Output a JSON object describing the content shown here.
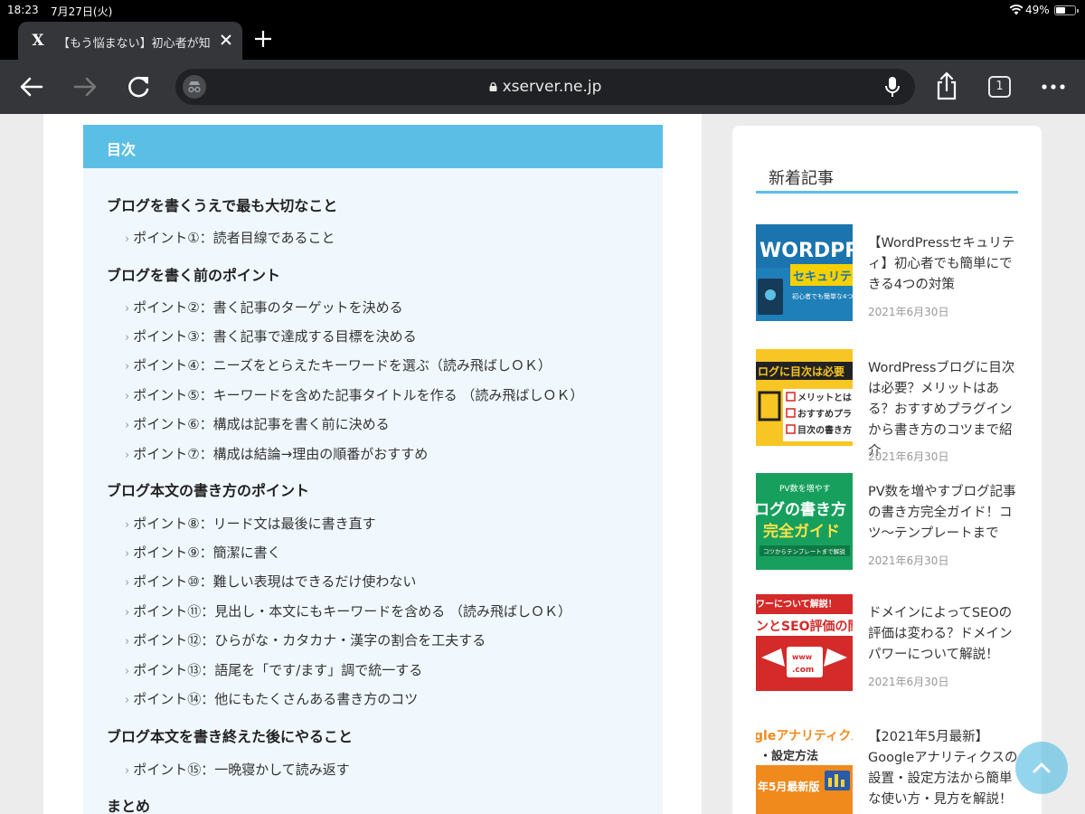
{
  "status_bar": {
    "time": "18:23",
    "date": "7月27日(火)",
    "battery": "49%",
    "battery_level": 0.49
  },
  "browser": {
    "tab_title": "【もう悩まない】初心者が知",
    "url": "xserver.ne.jp",
    "tab_count": "1",
    "favicon": "X"
  },
  "toc": {
    "header": "目次",
    "items": [
      {
        "level": "h2",
        "text": "ブログを書くうえで最も大切なこと"
      },
      {
        "level": "h3",
        "text": "ポイント①：読者目線であること"
      },
      {
        "level": "h2",
        "text": "ブログを書く前のポイント"
      },
      {
        "level": "h3",
        "text": "ポイント②：書く記事のターゲットを決める"
      },
      {
        "level": "h3",
        "text": "ポイント③：書く記事で達成する目標を決める"
      },
      {
        "level": "h3",
        "text": "ポイント④：ニーズをとらえたキーワードを選ぶ（読み飛ばしＯＫ）"
      },
      {
        "level": "h3",
        "text": "ポイント⑤：キーワードを含めた記事タイトルを作る （読み飛ばしＯＫ）"
      },
      {
        "level": "h3",
        "text": "ポイント⑥：構成は記事を書く前に決める"
      },
      {
        "level": "h3",
        "text": "ポイント⑦：構成は結論→理由の順番がおすすめ"
      },
      {
        "level": "h2",
        "text": "ブログ本文の書き方のポイント"
      },
      {
        "level": "h3",
        "text": "ポイント⑧：リード文は最後に書き直す"
      },
      {
        "level": "h3",
        "text": "ポイント⑨：簡潔に書く"
      },
      {
        "level": "h3",
        "text": "ポイント⑩：難しい表現はできるだけ使わない"
      },
      {
        "level": "h3",
        "text": "ポイント⑪：見出し・本文にもキーワードを含める （読み飛ばしＯＫ）"
      },
      {
        "level": "h3",
        "text": "ポイント⑫：ひらがな・カタカナ・漢字の割合を工夫する"
      },
      {
        "level": "h3",
        "text": "ポイント⑬：語尾を「です/ます」調で統一する"
      },
      {
        "level": "h3",
        "text": "ポイント⑭：他にもたくさんある書き方のコツ"
      },
      {
        "level": "h2",
        "text": "ブログ本文を書き終えた後にやること"
      },
      {
        "level": "h3",
        "text": "ポイント⑮：一晩寝かして読み返す"
      },
      {
        "level": "h2",
        "text": "まとめ"
      }
    ]
  },
  "sidebar": {
    "title": "新着記事",
    "posts": [
      {
        "title": "【WordPressセキュリティ】初心者でも簡単にできる4つの対策",
        "date": "2021年6月30日",
        "thumb": {
          "style": "wordpress",
          "line1": "WORDPRE",
          "line2": "セキュリティ対",
          "line3": "初心者でも簡単な4つ",
          "bg": "#1f7fb8",
          "accent": "#f5d000"
        }
      },
      {
        "title": "WordPressブログに目次は必要？メリットはある？おすすめプラグインから書き方のコツまで紹介",
        "date": "2021年6月30日",
        "thumb": {
          "style": "toc",
          "line1": "ログに目次は必要",
          "line2": "メリットとは",
          "line3": "おすすめプラ",
          "line4": "目次の書き方",
          "bg": "#f7c624"
        }
      },
      {
        "title": "PV数を増やすブログ記事の書き方完全ガイド！コツ〜テンプレートまで",
        "date": "2021年6月30日",
        "thumb": {
          "style": "guide",
          "line1": "PV数を増やす",
          "line2": "ログの書き方",
          "line3": "完全ガイド",
          "line4": "コツからテンプレートまで解説",
          "bg": "#17a05d"
        }
      },
      {
        "title": "ドメインによってSEOの評価は変わる？ドメインパワーについて解説！",
        "date": "2021年6月30日",
        "thumb": {
          "style": "seo",
          "line1": "ワーについて解説！",
          "line2": "ンとSEO評価の関係",
          "line3": "www",
          "line4": ".com",
          "bg": "#d42a2a"
        }
      },
      {
        "title": "【2021年5月最新】Googleアナリティクスの設置・設定方法から簡単な使い方・見方を解説！",
        "date": "",
        "thumb": {
          "style": "ga",
          "line1": "gleアナリティクス",
          "line2": "・設定方法",
          "line3": "年5月最新版",
          "bg": "#f08a1c"
        }
      }
    ]
  }
}
